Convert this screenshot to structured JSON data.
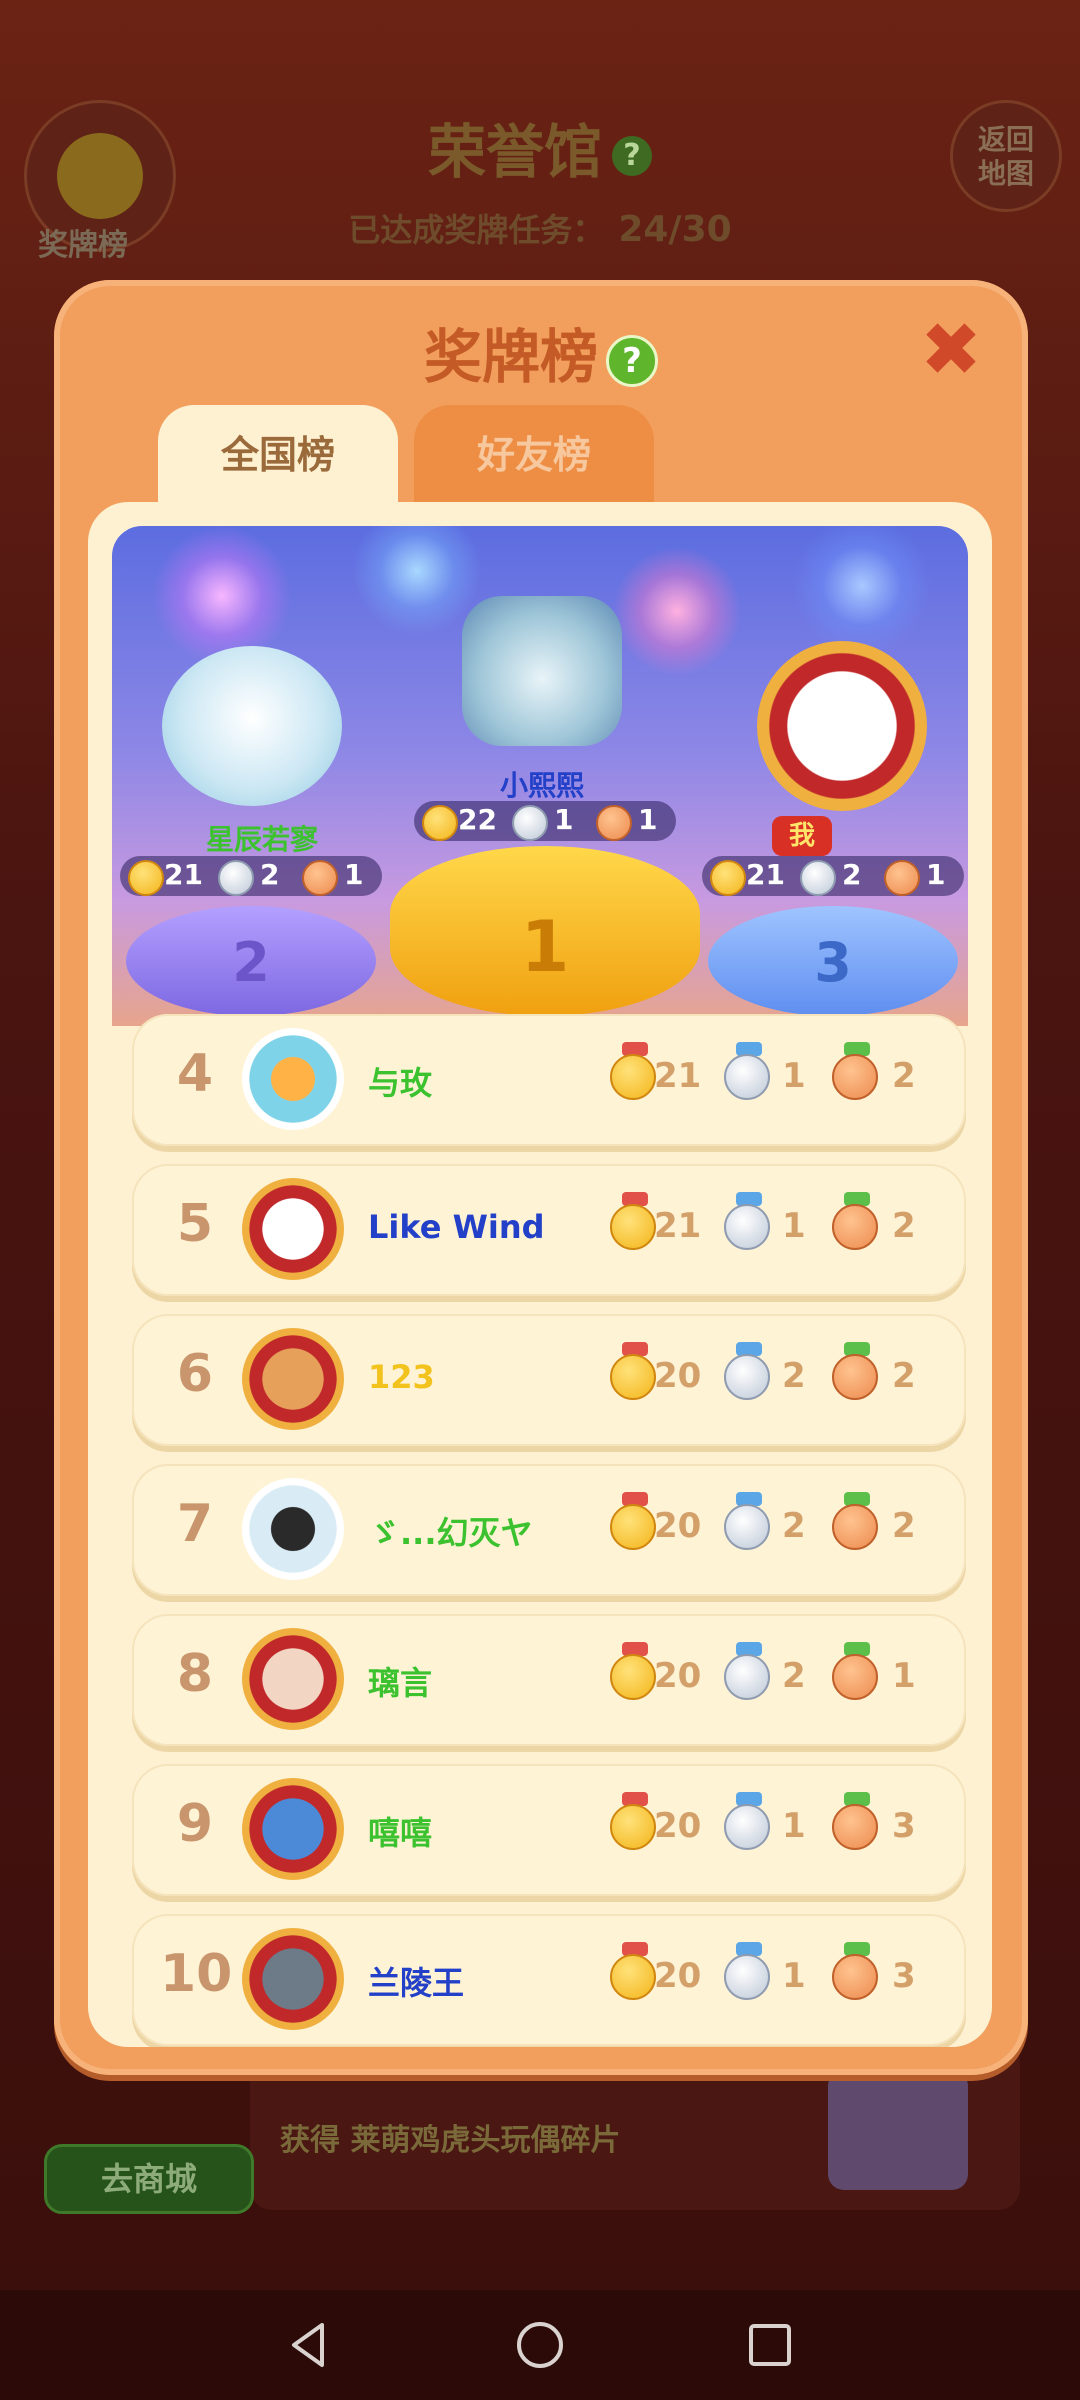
{
  "background": {
    "title": "荣誉馆",
    "help_glyph": "?",
    "progress_label": "已达成奖牌任务：",
    "progress_value": "24/30",
    "medal_button_label": "奖牌榜",
    "back_button_label_line1": "返回",
    "back_button_label_line2": "地图",
    "reward_prefix": "获得",
    "reward_item": "莱萌鸡虎头玩偶碎片",
    "shop_button_label": "去商城"
  },
  "modal": {
    "title": "奖牌榜",
    "help_glyph": "?",
    "close_glyph": "✖",
    "tabs": [
      {
        "label": "全国榜",
        "active": true
      },
      {
        "label": "好友榜",
        "active": false
      }
    ]
  },
  "podium": {
    "first": {
      "rank": "1",
      "name": "小熙熙",
      "gold": "22",
      "silver": "1",
      "bronze": "1"
    },
    "second": {
      "rank": "2",
      "name": "星辰若寥",
      "gold": "21",
      "silver": "2",
      "bronze": "1"
    },
    "third": {
      "rank": "3",
      "name": "我",
      "gold": "21",
      "silver": "2",
      "bronze": "1"
    }
  },
  "rows": [
    {
      "rank": "4",
      "name": "与玫",
      "name_color": "#3bc22e",
      "gold": "21",
      "silver": "1",
      "bronze": "2"
    },
    {
      "rank": "5",
      "name": "Like Wind",
      "name_color": "#2340c8",
      "gold": "21",
      "silver": "1",
      "bronze": "2"
    },
    {
      "rank": "6",
      "name": "123",
      "name_color": "#f2c21d",
      "gold": "20",
      "silver": "2",
      "bronze": "2"
    },
    {
      "rank": "7",
      "name": "ゞ...幻灭ヤ",
      "name_color": "#3bc22e",
      "gold": "20",
      "silver": "2",
      "bronze": "2"
    },
    {
      "rank": "8",
      "name": "璃言",
      "name_color": "#3bc22e",
      "gold": "20",
      "silver": "2",
      "bronze": "1"
    },
    {
      "rank": "9",
      "name": "嘻嘻",
      "name_color": "#3bc22e",
      "gold": "20",
      "silver": "1",
      "bronze": "3"
    },
    {
      "rank": "10",
      "name": "兰陵王",
      "name_color": "#2340c8",
      "gold": "20",
      "silver": "1",
      "bronze": "3"
    }
  ],
  "colors": {
    "gold": "#f3b419",
    "silver": "#bcc7d6",
    "bronze": "#ec8a4e",
    "accent": "#c45a25"
  },
  "icons": [
    "help-icon",
    "close-icon",
    "gold-medal-icon",
    "silver-medal-icon",
    "bronze-medal-icon",
    "back-nav-icon",
    "home-nav-icon",
    "recents-nav-icon"
  ]
}
